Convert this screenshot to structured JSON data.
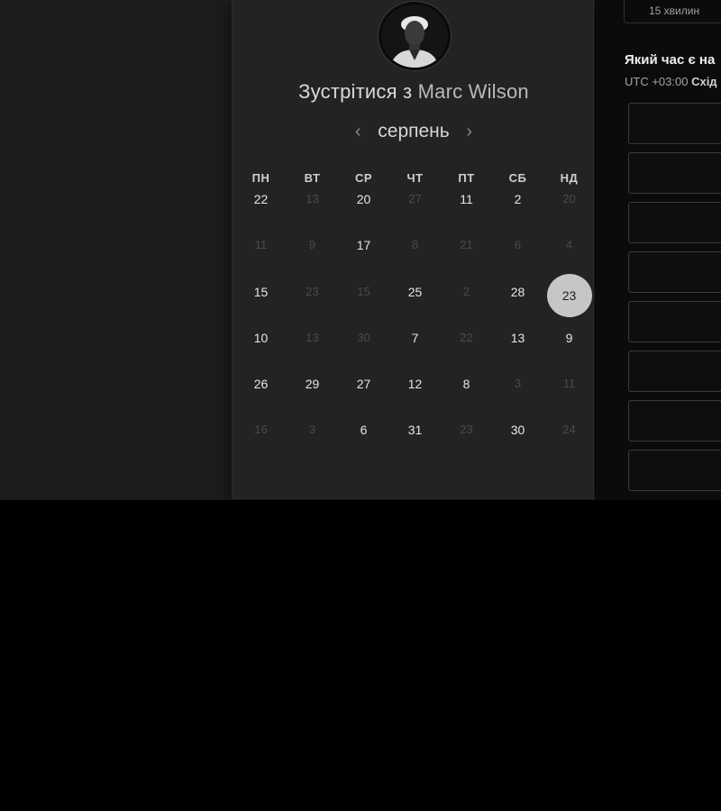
{
  "card": {
    "title_prefix": "Зустрітися з",
    "host_name": "Marc Wilson",
    "month": "серпень",
    "prev_arrow": "‹",
    "next_arrow": "›"
  },
  "weekdays": [
    "ПН",
    "ВТ",
    "СР",
    "ЧТ",
    "ПТ",
    "СБ",
    "НД"
  ],
  "days": [
    [
      "22",
      "13",
      "20",
      "27",
      "11",
      "2",
      "20"
    ],
    [
      "11",
      "9",
      "17",
      "8",
      "21",
      "6",
      "4"
    ],
    [
      "15",
      "23",
      "15",
      "25",
      "2",
      "28",
      "23"
    ],
    [
      "10",
      "13",
      "30",
      "7",
      "22",
      "13",
      "9"
    ],
    [
      "26",
      "29",
      "27",
      "12",
      "8",
      "3",
      "11"
    ],
    [
      "16",
      "3",
      "6",
      "31",
      "23",
      "30",
      "24"
    ]
  ],
  "day_states": [
    [
      "a",
      "d",
      "a",
      "d",
      "a",
      "a",
      "d"
    ],
    [
      "d",
      "d",
      "a",
      "d",
      "d",
      "d",
      "d"
    ],
    [
      "a",
      "d",
      "d",
      "a",
      "d",
      "a",
      "s"
    ],
    [
      "a",
      "d",
      "d",
      "a",
      "d",
      "a",
      "a"
    ],
    [
      "a",
      "a",
      "a",
      "a",
      "a",
      "d",
      "d"
    ],
    [
      "d",
      "d",
      "a",
      "a",
      "d",
      "a",
      "d"
    ]
  ],
  "right": {
    "duration": "15 хвилин",
    "tz_question": "Який час є на",
    "tz_offset": "UTC +03:00",
    "tz_name": "Схід"
  },
  "colors": {
    "background": "#1c1c1c",
    "card": "#232323",
    "selected_day": "#c6c6c6",
    "available_day_text": "#e6e6e6",
    "unavailable_day_text": "#4a4a4a"
  }
}
